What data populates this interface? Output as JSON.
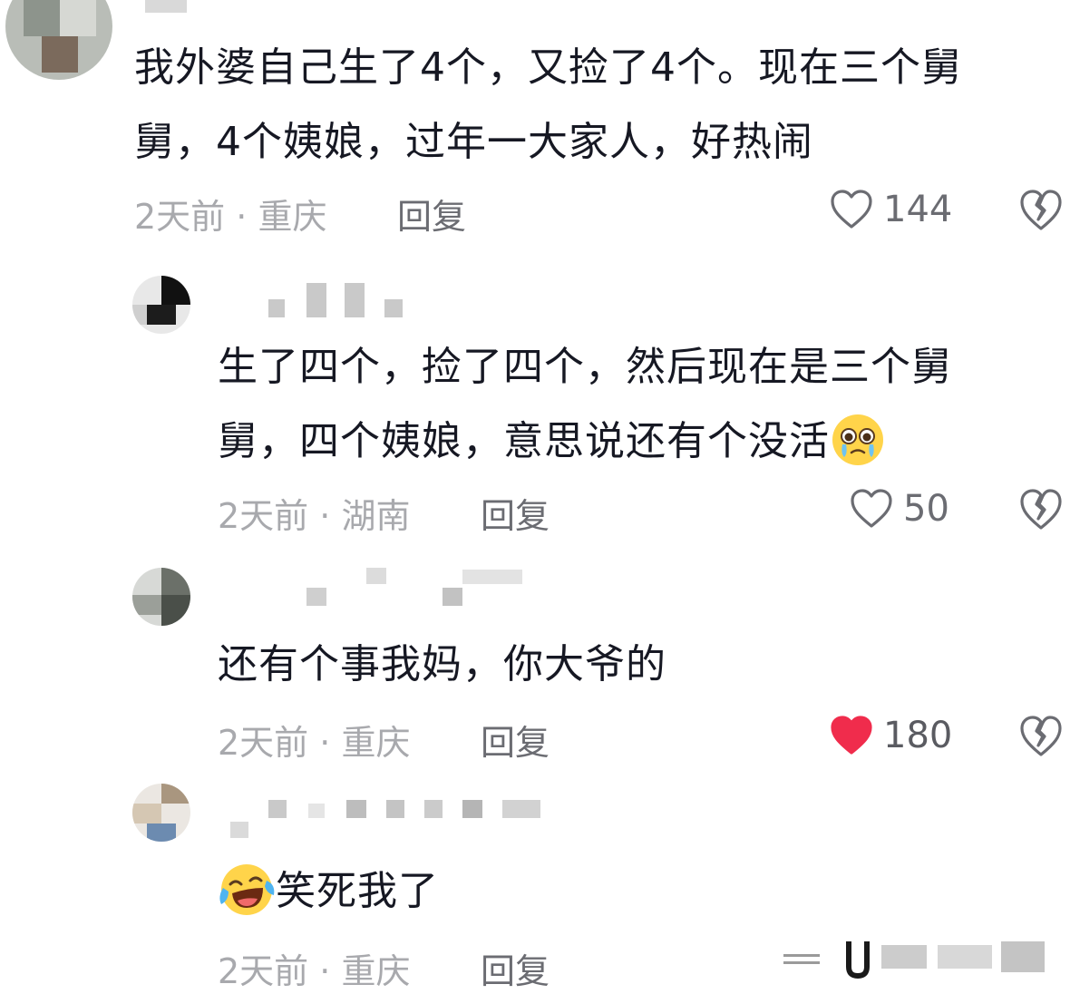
{
  "comments": [
    {
      "text_line1": "我外婆自己生了4个，又捡了4个。现在三个舅",
      "text_line2": "舅，4个姨娘，过年一大家人，好热闹",
      "time": "2天前",
      "dot": "·",
      "location": "重庆",
      "reply": "回复",
      "likes": "144",
      "liked": false
    },
    {
      "text_line1": "生了四个，捡了四个，然后现在是三个舅",
      "text_line2": "舅，四个姨娘，意思说还有个没活",
      "emoji_name": "crying-face-emoji",
      "time": "2天前",
      "dot": "·",
      "location": "湖南",
      "reply": "回复",
      "likes": "50",
      "liked": false
    },
    {
      "text_line1": "还有个事我妈，你大爷的",
      "time": "2天前",
      "dot": "·",
      "location": "重庆",
      "reply": "回复",
      "likes": "180",
      "liked": true
    },
    {
      "text_line1": "笑死我了",
      "emoji_name": "laughing-crying-emoji",
      "time": "2天前",
      "dot": "·",
      "location": "重庆",
      "reply": "回复"
    }
  ],
  "icons": {
    "heart": "heart-icon",
    "dislike": "broken-heart-icon"
  },
  "colors": {
    "liked_heart": "#f02c4c",
    "text": "#161823",
    "meta": "#a8a9ad",
    "reply": "#6b6c72"
  }
}
